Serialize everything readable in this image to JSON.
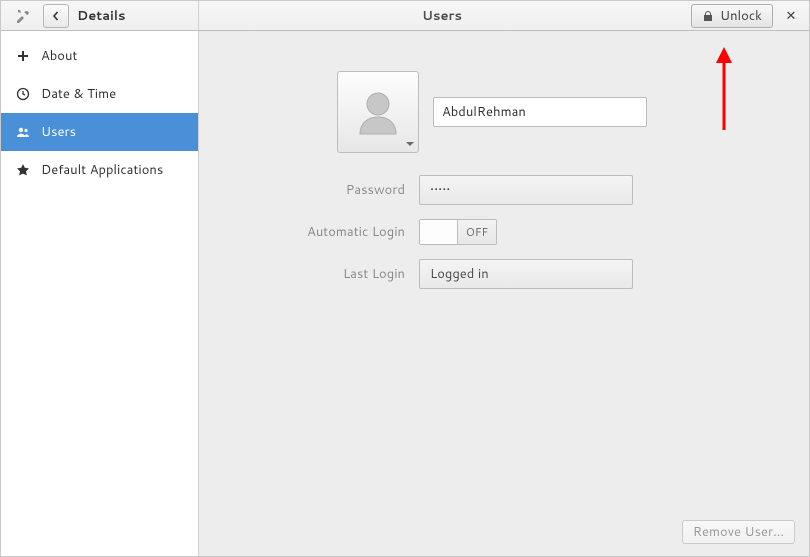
{
  "header": {
    "back_section_title": "Details",
    "page_title": "Users",
    "unlock_label": "Unlock"
  },
  "sidebar": {
    "items": [
      {
        "label": "About"
      },
      {
        "label": "Date & Time"
      },
      {
        "label": "Users"
      },
      {
        "label": "Default Applications"
      }
    ],
    "selected_index": 2
  },
  "user": {
    "name_value": "AbdulRehman",
    "password_label": "Password",
    "password_masked": "•••••",
    "autologin_label": "Automatic Login",
    "autologin_state": "OFF",
    "lastlogin_label": "Last Login",
    "lastlogin_value": "Logged in"
  },
  "footer": {
    "remove_label": "Remove User..."
  }
}
